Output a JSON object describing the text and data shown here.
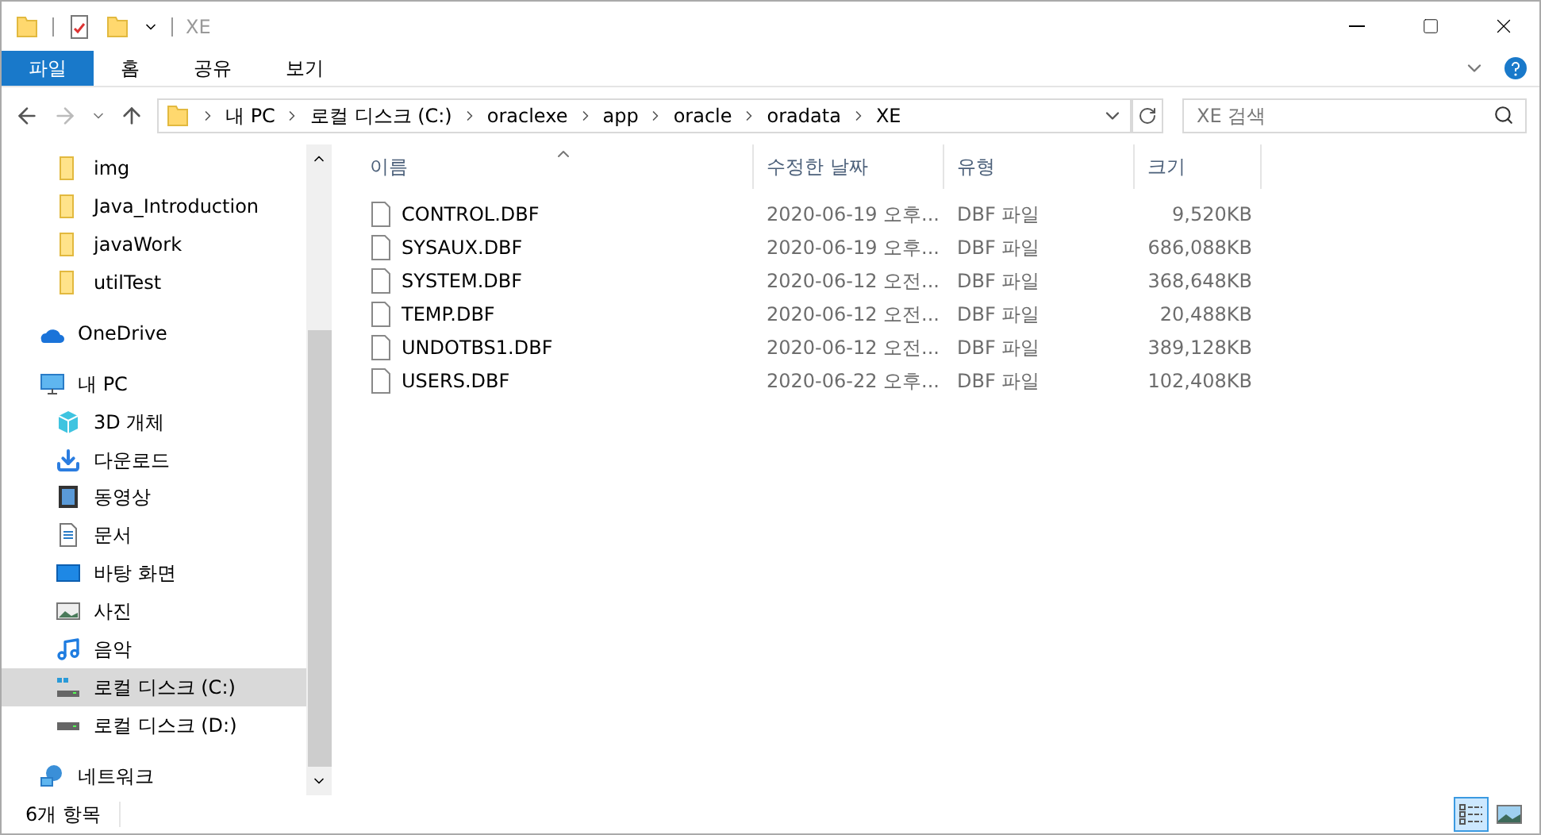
{
  "window": {
    "title": "XE"
  },
  "ribbon_tabs": [
    {
      "label": "파일",
      "selected": true
    },
    {
      "label": "홈",
      "selected": false
    },
    {
      "label": "공유",
      "selected": false
    },
    {
      "label": "보기",
      "selected": false
    }
  ],
  "address": {
    "path": [
      "내 PC",
      "로컬 디스크 (C:)",
      "oraclexe",
      "app",
      "oracle",
      "oradata",
      "XE"
    ]
  },
  "search": {
    "placeholder": "XE 검색"
  },
  "nav": [
    {
      "label": "img",
      "kind": "folder",
      "selected": false
    },
    {
      "label": "Java_Introduction",
      "kind": "folder",
      "selected": false
    },
    {
      "label": "javaWork",
      "kind": "folder",
      "selected": false
    },
    {
      "label": "utilTest",
      "kind": "folder",
      "selected": false
    },
    {
      "label": "OneDrive",
      "kind": "cloud",
      "selected": false
    },
    {
      "label": "내 PC",
      "kind": "pc",
      "selected": false,
      "children": [
        {
          "label": "3D 개체",
          "kind": "cube",
          "selected": false
        },
        {
          "label": "다운로드",
          "kind": "download",
          "selected": false
        },
        {
          "label": "동영상",
          "kind": "video",
          "selected": false
        },
        {
          "label": "문서",
          "kind": "document",
          "selected": false
        },
        {
          "label": "바탕 화면",
          "kind": "desktop",
          "selected": false
        },
        {
          "label": "사진",
          "kind": "photo",
          "selected": false
        },
        {
          "label": "음악",
          "kind": "music",
          "selected": false
        },
        {
          "label": "로컬 디스크 (C:)",
          "kind": "systemdrive",
          "selected": true
        },
        {
          "label": "로컬 디스크 (D:)",
          "kind": "drive",
          "selected": false
        }
      ]
    },
    {
      "label": "네트워크",
      "kind": "network",
      "selected": false
    }
  ],
  "table": {
    "columns": [
      "이름",
      "수정한 날짜",
      "유형",
      "크기"
    ],
    "rows": [
      [
        "CONTROL.DBF",
        "2020-06-19 오후...",
        "DBF 파일",
        "9,520KB"
      ],
      [
        "SYSAUX.DBF",
        "2020-06-19 오후...",
        "DBF 파일",
        "686,088KB"
      ],
      [
        "SYSTEM.DBF",
        "2020-06-12 오전...",
        "DBF 파일",
        "368,648KB"
      ],
      [
        "TEMP.DBF",
        "2020-06-12 오전...",
        "DBF 파일",
        "20,488KB"
      ],
      [
        "UNDOTBS1.DBF",
        "2020-06-12 오전...",
        "DBF 파일",
        "389,128KB"
      ],
      [
        "USERS.DBF",
        "2020-06-22 오후...",
        "DBF 파일",
        "102,408KB"
      ]
    ]
  },
  "status_bar": {
    "count": "6개 항목"
  },
  "view_buttons": [
    {
      "kind": "details",
      "selected": true
    },
    {
      "kind": "large",
      "selected": false
    }
  ]
}
